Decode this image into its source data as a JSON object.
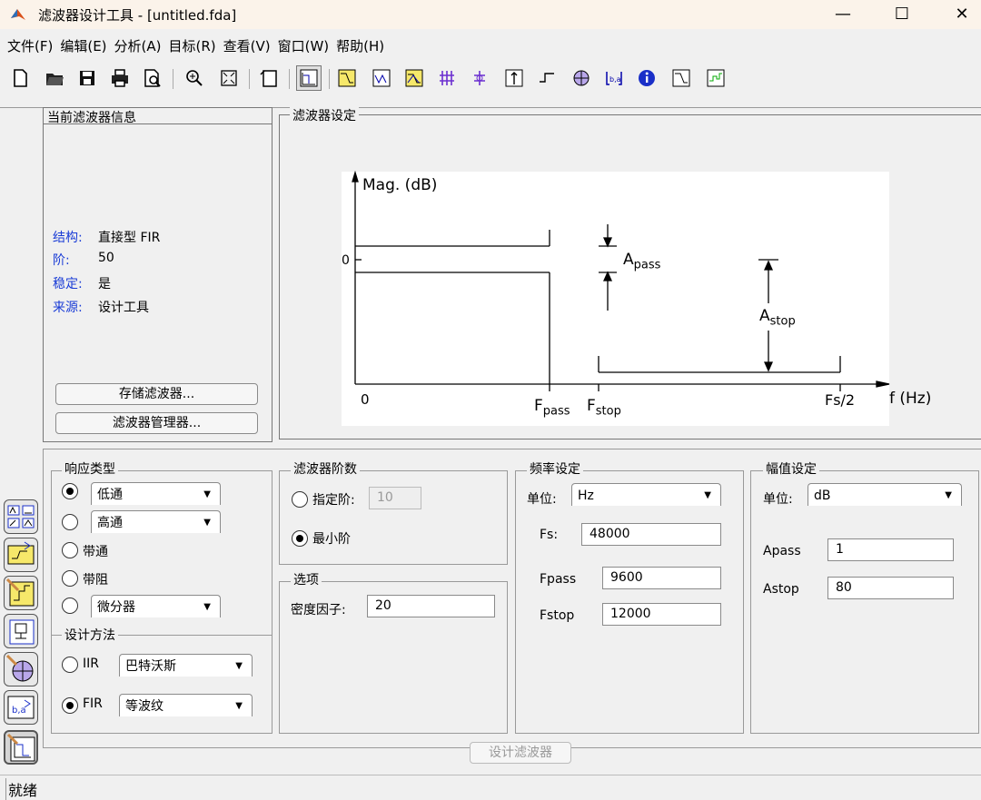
{
  "window": {
    "title": "滤波器设计工具 - [untitled.fda]",
    "minimize": "—",
    "maximize": "☐",
    "close": "✕"
  },
  "menu": [
    "文件(F)",
    "编辑(E)",
    "分析(A)",
    "目标(R)",
    "查看(V)",
    "窗口(W)",
    "帮助(H)"
  ],
  "info_panel": {
    "title": "当前滤波器信息",
    "rows": [
      {
        "label": "结构:",
        "value": "直接型 FIR"
      },
      {
        "label": "阶:",
        "value": "50"
      },
      {
        "label": "稳定:",
        "value": "是"
      },
      {
        "label": "来源:",
        "value": "设计工具"
      }
    ],
    "store_button": "存储滤波器...",
    "manager_button": "滤波器管理器..."
  },
  "spec_panel": {
    "title": "滤波器设定",
    "ylabel": "Mag. (dB)",
    "zero_y": "0",
    "zero_x": "0",
    "xlabel": "f (Hz)",
    "fpass": "F",
    "fpass_sub": "pass",
    "fstop": "F",
    "fstop_sub": "stop",
    "fs2": "Fs/2",
    "apass": "A",
    "apass_sub": "pass",
    "astop": "A",
    "astop_sub": "stop"
  },
  "response_type": {
    "title": "响应类型",
    "lowpass": "低通",
    "highpass": "高通",
    "bandpass": "带通",
    "bandstop": "带阻",
    "differentiator": "微分器"
  },
  "design_method": {
    "title": "设计方法",
    "iir_label": "IIR",
    "iir_value": "巴特沃斯",
    "fir_label": "FIR",
    "fir_value": "等波纹"
  },
  "filter_order": {
    "title": "滤波器阶数",
    "specify_label": "指定阶:",
    "specify_value": "10",
    "minimum_label": "最小阶"
  },
  "options": {
    "title": "选项",
    "density_label": "密度因子:",
    "density_value": "20"
  },
  "freq_spec": {
    "title": "频率设定",
    "units_label": "单位:",
    "units_value": "Hz",
    "fs_label": "Fs:",
    "fs_value": "48000",
    "fpass_label": "Fpass",
    "fpass_value": "9600",
    "fstop_label": "Fstop",
    "fstop_value": "12000"
  },
  "mag_spec": {
    "title": "幅值设定",
    "units_label": "单位:",
    "units_value": "dB",
    "apass_label": "Apass",
    "apass_value": "1",
    "astop_label": "Astop",
    "astop_value": "80"
  },
  "design_button": "设计滤波器",
  "status": "就绪"
}
